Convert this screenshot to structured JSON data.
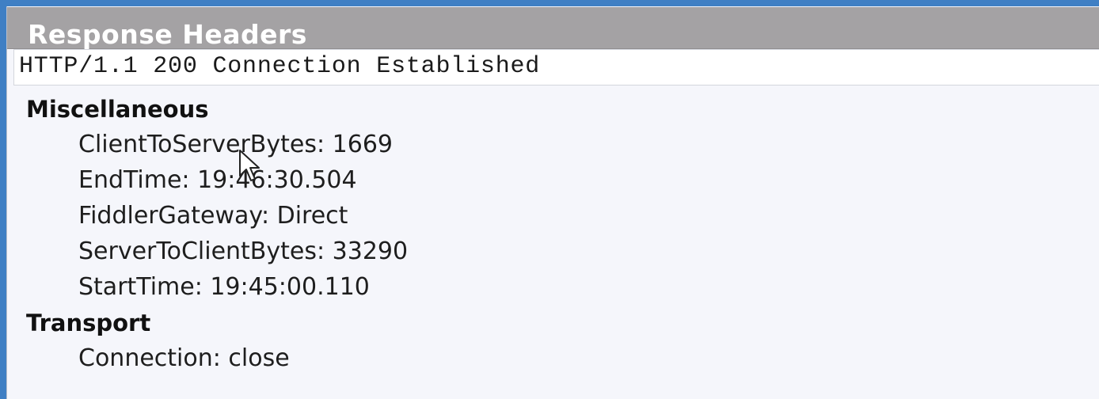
{
  "panel": {
    "title": "Response Headers",
    "status_line": "HTTP/1.1 200 Connection Established"
  },
  "groups": [
    {
      "name": "Miscellaneous",
      "items": [
        "ClientToServerBytes: 1669",
        "EndTime: 19:46:30.504",
        "FiddlerGateway: Direct",
        "ServerToClientBytes: 33290",
        "StartTime: 19:45:00.110"
      ]
    },
    {
      "name": "Transport",
      "items": [
        "Connection: close"
      ]
    }
  ],
  "colors": {
    "title_bar": "#a4a2a4",
    "window_border": "#3f7fc4",
    "panel_background": "#f5f6fb"
  },
  "icons": {
    "cursor": "mouse-pointer-icon"
  }
}
